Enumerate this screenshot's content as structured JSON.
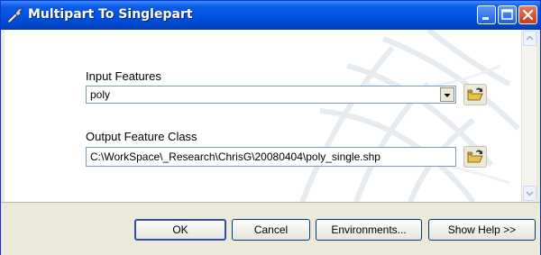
{
  "window": {
    "title": "Multipart To Singlepart",
    "title_icon": "wrench-tool-icon"
  },
  "form": {
    "input_label": "Input Features",
    "input_value": "poly",
    "output_label": "Output Feature Class",
    "output_value": "C:\\WorkSpace\\_Research\\ChrisG\\20080404\\poly_single.shp"
  },
  "buttons": {
    "ok": "OK",
    "cancel": "Cancel",
    "environments": "Environments...",
    "show_help": "Show Help >>"
  },
  "colors": {
    "titlebar": "#0053e1",
    "dialog_face": "#ece9d8",
    "close_button": "#c8391c"
  }
}
